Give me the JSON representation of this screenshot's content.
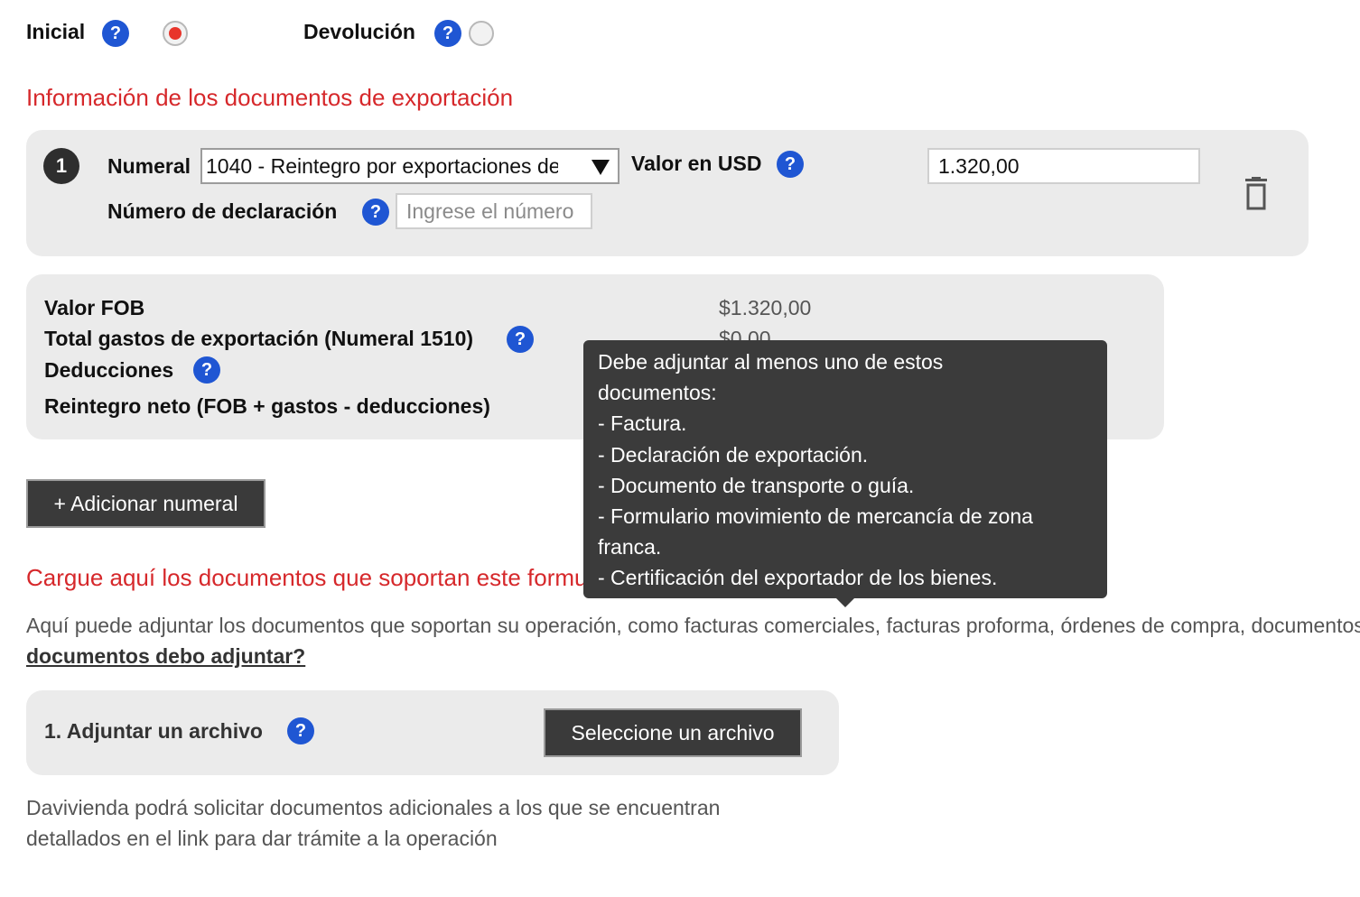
{
  "type_selector": {
    "initial_label": "Inicial",
    "return_label": "Devolución",
    "selected": "Inicial"
  },
  "export_docs": {
    "title": "Información de los documentos de exportación",
    "item": {
      "index": "1",
      "numeral_label": "Numeral",
      "numeral_value": "1040 - Reintegro por exportaciones de",
      "usd_label": "Valor en USD",
      "usd_value": "1.320,00",
      "declaration_label": "Número de declaración",
      "declaration_placeholder": "Ingrese el número"
    }
  },
  "summary": {
    "fob_label": "Valor FOB",
    "fob_value": "$1.320,00",
    "expenses_label": "Total gastos de exportación (Numeral 1510)",
    "expenses_value": "$0,00",
    "deductions_label": "Deducciones",
    "net_label": "Reintegro neto (FOB + gastos - deducciones)"
  },
  "add_numeral_label": "+ Adicionar numeral",
  "upload": {
    "title": "Cargue aquí los documentos que soportan este formulario",
    "description": "Aquí puede adjuntar los documentos que soportan su operación, como facturas comerciales, facturas proforma, órdenes de compra, documentos",
    "link": "documentos debo adjuntar?",
    "attach_label": "1. Adjuntar un archivo",
    "select_file_label": "Seleccione un archivo",
    "note_line1": "Davivienda podrá solicitar documentos adicionales a los que se encuentran",
    "note_line2": "detallados en el link para dar trámite a la operación"
  },
  "tooltip": {
    "lines": [
      "Debe adjuntar al menos uno de estos",
      "documentos:",
      "- Factura.",
      "- Declaración de exportación.",
      "- Documento de transporte o guía.",
      "- Formulario movimiento de mercancía de zona",
      "franca.",
      "- Certificación del exportador de los bienes."
    ]
  },
  "icons": {
    "help": "?",
    "delete": "trash-icon"
  },
  "colors": {
    "accent_red": "#d6282b",
    "help_blue": "#1f56d3",
    "dark_button": "#3a3a3a",
    "panel_gray": "#ebebeb"
  }
}
